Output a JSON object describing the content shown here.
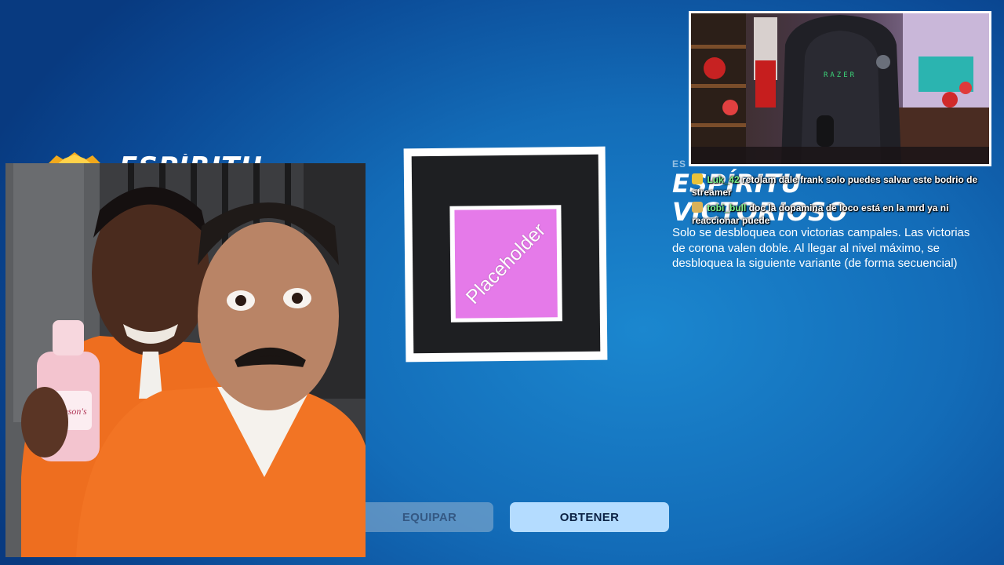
{
  "header": {
    "title": "ESPÍRITU"
  },
  "preview": {
    "placeholder_label": "Placeholder"
  },
  "buttons": {
    "equip_label": "EQUIPAR",
    "get_label": "OBTENER"
  },
  "item": {
    "type_label": "ES",
    "name_line1": "ESPÍRITU",
    "name_line2": "VICTORIOSO",
    "description": "Solo se desbloquea con victorias campales. Las victorias de corona valen doble. Al llegar al nivel máximo, se desbloquea la siguiente variante (de forma secuencial)"
  },
  "webcam": {
    "chair_brand": "RAZER"
  },
  "chat": {
    "messages": [
      {
        "user": "Luk_42",
        "text": "retolam dale frank solo puedes salvar este bodrio de streamer"
      },
      {
        "user": "tobi_bull",
        "text": "doc la dopamina de loco está en la mrd ya ni reaccionar puede"
      }
    ]
  },
  "photo": {
    "bottle_brand": "Johnson's"
  },
  "colors": {
    "background": "#136cb8",
    "get_button": "#b4dcff",
    "equip_button": "#96b4d2",
    "placeholder_fill": "#e57ae9",
    "chat_username": "#7cf08a"
  }
}
